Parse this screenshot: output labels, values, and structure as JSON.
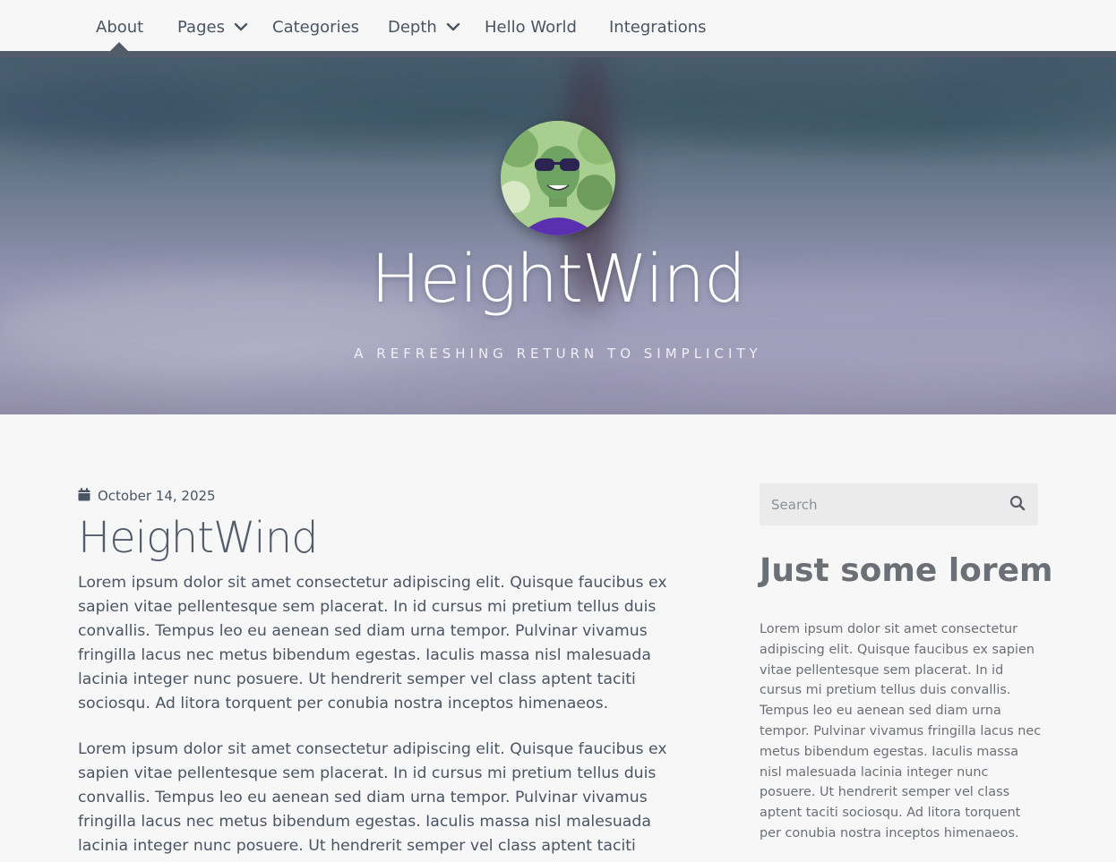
{
  "nav": {
    "items": [
      {
        "label": "About",
        "active": true
      },
      {
        "label": "Pages",
        "has_dropdown": true
      },
      {
        "label": "Categories"
      },
      {
        "label": "Depth",
        "has_dropdown": true
      },
      {
        "label": "Hello World"
      },
      {
        "label": "Integrations"
      }
    ]
  },
  "hero": {
    "title": "HeightWind",
    "subtitle": "A REFRESHING RETURN TO SIMPLICITY"
  },
  "post": {
    "date": "October 14, 2025",
    "title": "HeightWind",
    "paragraphs": [
      "Lorem ipsum dolor sit amet consectetur adipiscing elit. Quisque faucibus ex sapien vitae pellentesque sem placerat. In id cursus mi pretium tellus duis convallis. Tempus leo eu aenean sed diam urna tempor. Pulvinar vivamus fringilla lacus nec metus bibendum egestas. Iaculis massa nisl malesuada lacinia integer nunc posuere. Ut hendrerit semper vel class aptent taciti sociosqu. Ad litora torquent per conubia nostra inceptos himenaeos.",
      "Lorem ipsum dolor sit amet consectetur adipiscing elit. Quisque faucibus ex sapien vitae pellentesque sem placerat. In id cursus mi pretium tellus duis convallis. Tempus leo eu aenean sed diam urna tempor. Pulvinar vivamus fringilla lacus nec metus bibendum egestas. Iaculis massa nisl malesuada lacinia integer nunc posuere. Ut hendrerit semper vel class aptent taciti sociosqu. Ad litora"
    ]
  },
  "sidebar": {
    "search_placeholder": "Search",
    "widget_title": "Just some lorem",
    "widget_text": "Lorem ipsum dolor sit amet consectetur adipiscing elit. Quisque faucibus ex sapien vitae pellentesque sem placerat. In id cursus mi pretium tellus duis convallis. Tempus leo eu aenean sed diam urna tempor. Pulvinar vivamus fringilla lacus nec metus bibendum egestas. Iaculis massa nisl malesuada lacinia integer nunc posuere. Ut hendrerit semper vel class aptent taciti sociosqu. Ad litora torquent per conubia nostra inceptos himenaeos."
  },
  "icons": {
    "date": "calendar-icon",
    "search": "search-icon",
    "dropdown": "chevron-down-icon"
  },
  "colors": {
    "accent": "#525c6b",
    "background": "#f7f7f7",
    "text": "#4b5563"
  }
}
